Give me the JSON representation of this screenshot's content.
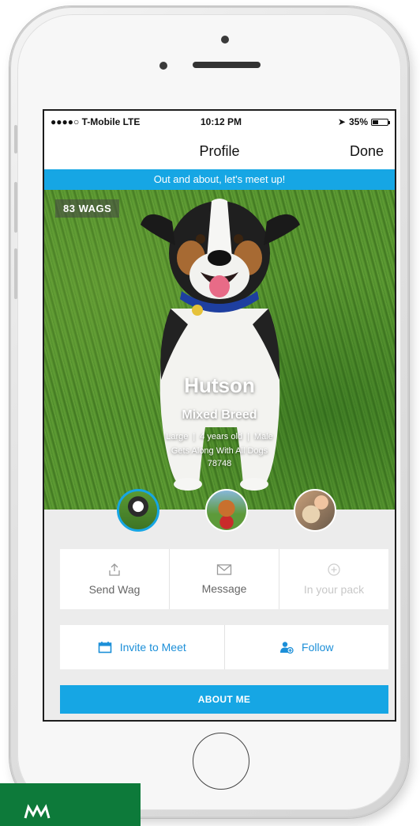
{
  "status_bar": {
    "carrier": "●●●●○ T-Mobile  LTE",
    "time": "10:12 PM",
    "battery": "35%",
    "battery_level": 0.35
  },
  "nav": {
    "title": "Profile",
    "done_label": "Done"
  },
  "banner": {
    "text": "Out and about, let's meet up!"
  },
  "profile": {
    "wags": "83 WAGS",
    "name": "Hutson",
    "breed": "Mixed Breed",
    "size": "Large",
    "age": "4 years old",
    "sex": "Male",
    "along": "Gets Along With All Dogs",
    "zip": "78748"
  },
  "actions": [
    {
      "label": "Send Wag",
      "icon": "upload-icon",
      "enabled": true
    },
    {
      "label": "Message",
      "icon": "envelope-icon",
      "enabled": true
    },
    {
      "label": "In your pack",
      "icon": "plus-circle-icon",
      "enabled": false
    }
  ],
  "meet": {
    "invite_label": "Invite to Meet",
    "follow_label": "Follow"
  },
  "about": {
    "label": "ABOUT ME"
  },
  "colors": {
    "accent": "#16a6e4",
    "link_blue": "#1c8fd8",
    "corner_green": "#0d7a3a"
  }
}
